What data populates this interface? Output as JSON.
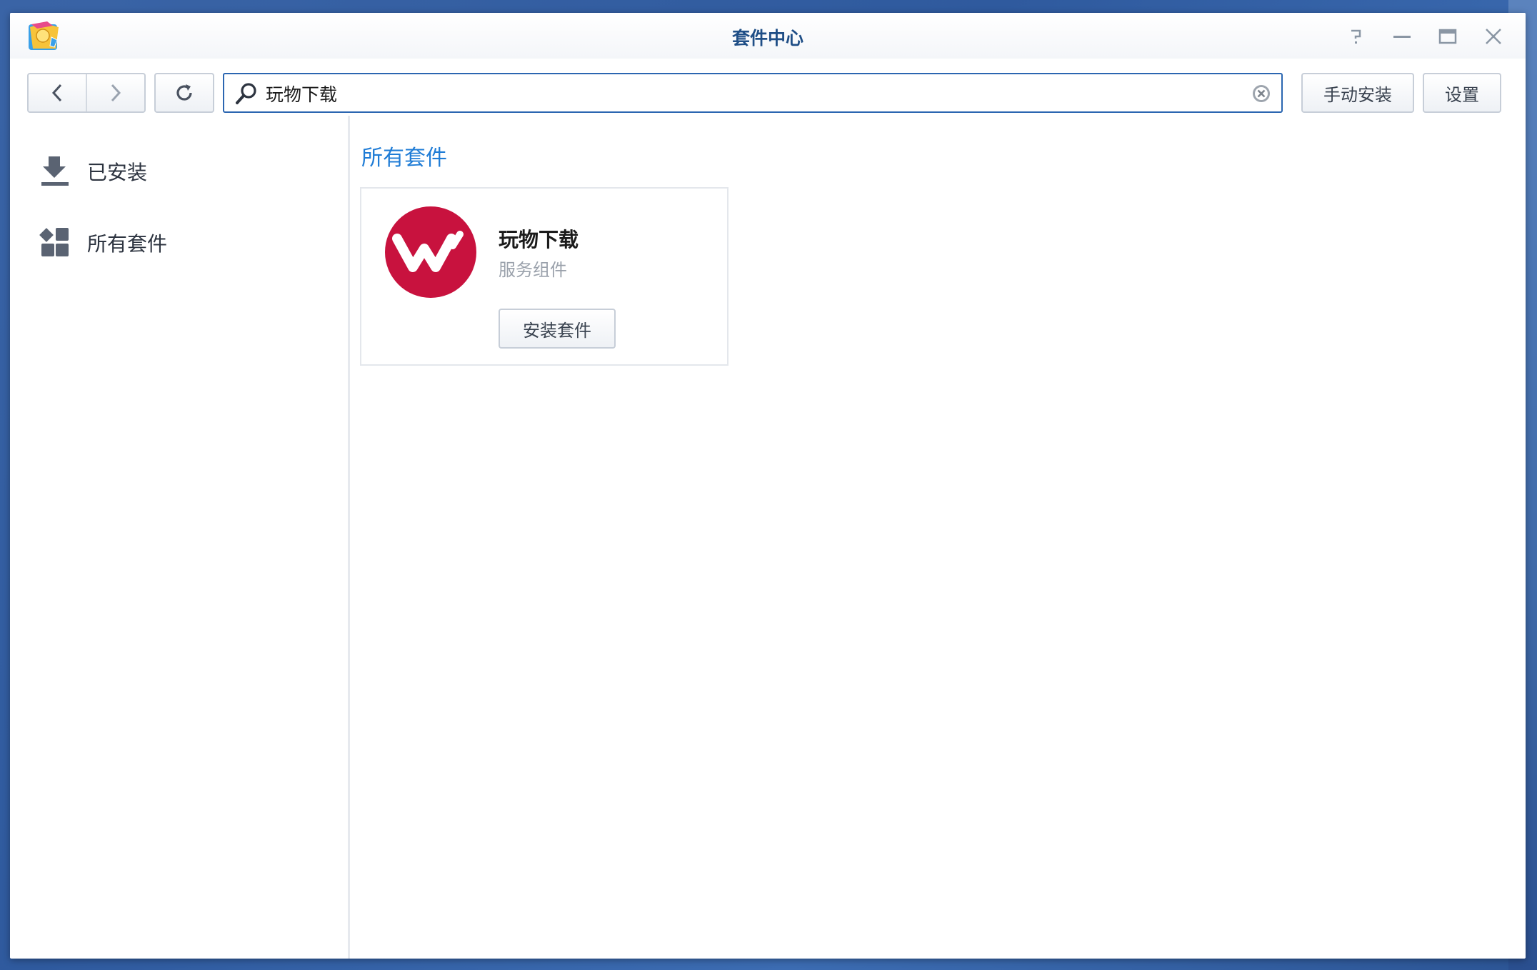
{
  "window": {
    "title": "套件中心",
    "controls": {
      "help_icon": "help-icon",
      "minimize_icon": "minimize-icon",
      "maximize_icon": "maximize-icon",
      "close_icon": "close-icon"
    }
  },
  "toolbar": {
    "back_icon": "chevron-left-icon",
    "forward_icon": "chevron-right-icon",
    "refresh_icon": "refresh-icon",
    "search": {
      "value": "玩物下载",
      "placeholder": ""
    },
    "manual_install_label": "手动安装",
    "settings_label": "设置"
  },
  "sidebar": {
    "items": [
      {
        "label": "已安装",
        "icon": "download-tray-icon"
      },
      {
        "label": "所有套件",
        "icon": "grid-icon"
      }
    ]
  },
  "main": {
    "section_title": "所有套件",
    "packages": [
      {
        "name": "玩物下载",
        "category": "服务组件",
        "install_label": "安装套件",
        "logo_color": "#c8123e"
      }
    ]
  },
  "colors": {
    "accent": "#1f7cd6",
    "title": "#1f4e86",
    "search_border": "#2b66b1",
    "desktop": "#3a64a6"
  }
}
